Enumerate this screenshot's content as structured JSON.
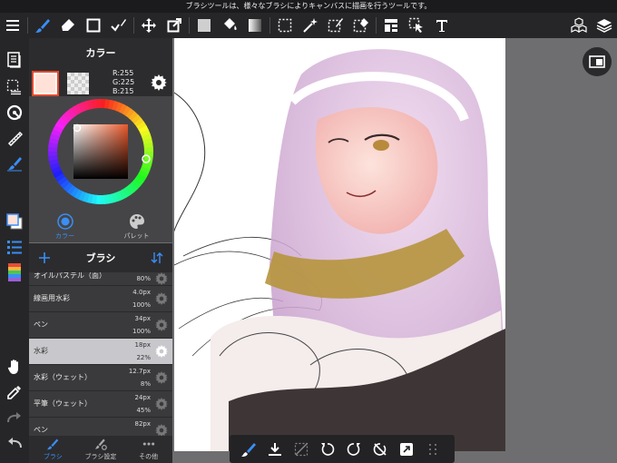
{
  "status_bar": {
    "text": "ブラシツールは、様々なブラシによりキャンバスに描画を行うツールです。"
  },
  "toolbar": {
    "icons": [
      "menu-icon",
      "brush-tool-icon",
      "eraser-tool-icon",
      "rect-shape-icon",
      "select-pen-icon",
      "move-icon",
      "transform-icon",
      "fill-color-icon",
      "bucket-icon",
      "gradient-icon",
      "select-rect-icon",
      "magic-wand-icon",
      "select-pen-plus-icon",
      "select-eraser-icon",
      "layout-icon",
      "move-layer-icon",
      "text-icon",
      "3d-icon",
      "layers-icon"
    ],
    "accent": "#3a8ef5"
  },
  "color_panel": {
    "title": "カラー",
    "main_color": "#ffe1d7",
    "r": "R:255",
    "g": "G:225",
    "b": "B:215",
    "tabs": [
      {
        "label": "カラー",
        "active": true
      },
      {
        "label": "パレット",
        "active": false
      }
    ]
  },
  "brush_panel": {
    "title": "ブラシ",
    "items": [
      {
        "name": "オイルパステル（面）",
        "size": "",
        "opacity": "80%",
        "selected": false
      },
      {
        "name": "線画用水彩",
        "size": "4.0px",
        "opacity": "100%",
        "selected": false
      },
      {
        "name": "ペン",
        "size": "34px",
        "opacity": "100%",
        "selected": false
      },
      {
        "name": "水彩",
        "size": "18px",
        "opacity": "22%",
        "selected": true
      },
      {
        "name": "水彩（ウェット）",
        "size": "12.7px",
        "opacity": "8%",
        "selected": false
      },
      {
        "name": "平筆（ウェット）",
        "size": "24px",
        "opacity": "45%",
        "selected": false
      },
      {
        "name": "ペン",
        "size": "82px",
        "opacity": "",
        "selected": false
      }
    ],
    "bottom_tabs": [
      {
        "label": "ブラシ",
        "active": true
      },
      {
        "label": "ブラシ設定",
        "active": false
      },
      {
        "label": "その他",
        "active": false
      }
    ]
  }
}
